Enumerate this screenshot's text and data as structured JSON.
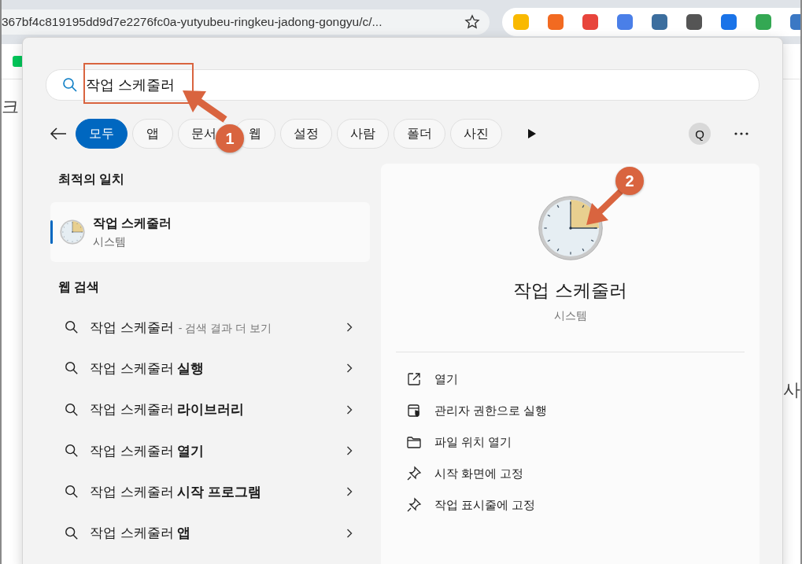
{
  "browser": {
    "url": "367bf4c819195dd9d7e2276fc0a-yutyubeu-ringkeu-jadong-gongyu/c/...",
    "extensions": [
      {
        "color": "#f9b900"
      },
      {
        "color": "#f26a21"
      },
      {
        "color": "#e8453c"
      },
      {
        "color": "#4a7fe8"
      },
      {
        "color": "#3c6e9e"
      },
      {
        "color": "#555555"
      },
      {
        "color": "#1a73e8"
      },
      {
        "color": "#34a853"
      },
      {
        "color": "#3b78c4"
      }
    ],
    "page_fragments": [
      "크",
      "사"
    ]
  },
  "search": {
    "value": "작업 스케줄러"
  },
  "filters": [
    {
      "label": "모두",
      "selected": true
    },
    {
      "label": "앱",
      "selected": false
    },
    {
      "label": "문서",
      "selected": false
    },
    {
      "label": "웹",
      "selected": false
    },
    {
      "label": "설정",
      "selected": false
    },
    {
      "label": "사람",
      "selected": false
    },
    {
      "label": "폴더",
      "selected": false
    },
    {
      "label": "사진",
      "selected": false
    }
  ],
  "account_initial": "Q",
  "best_match": {
    "heading": "최적의 일치",
    "title": "작업 스케줄러",
    "subtitle": "시스템",
    "selected": true
  },
  "web_search": {
    "heading": "웹 검색",
    "rows": [
      {
        "text": "작업 스케줄러",
        "hint": "- 검색 결과 더 보기"
      },
      {
        "text": "작업 스케줄러 **실행**"
      },
      {
        "text": "작업 스케줄러 **라이브러리**"
      },
      {
        "text": "작업 스케줄러 **열기**"
      },
      {
        "text": "작업 스케줄러 **시작 프로그램**"
      },
      {
        "text": "작업 스케줄러 **앱**"
      }
    ]
  },
  "detail": {
    "title": "작업 스케줄러",
    "subtitle": "시스템",
    "actions": [
      {
        "label": "열기",
        "kind": "open"
      },
      {
        "label": "관리자 권한으로 실행",
        "kind": "admin"
      },
      {
        "label": "파일 위치 열기",
        "kind": "folder"
      },
      {
        "label": "시작 화면에 고정",
        "kind": "pin"
      },
      {
        "label": "작업 표시줄에 고정",
        "kind": "pin"
      }
    ]
  },
  "annotations": [
    {
      "label": "1"
    },
    {
      "label": "2"
    }
  ]
}
